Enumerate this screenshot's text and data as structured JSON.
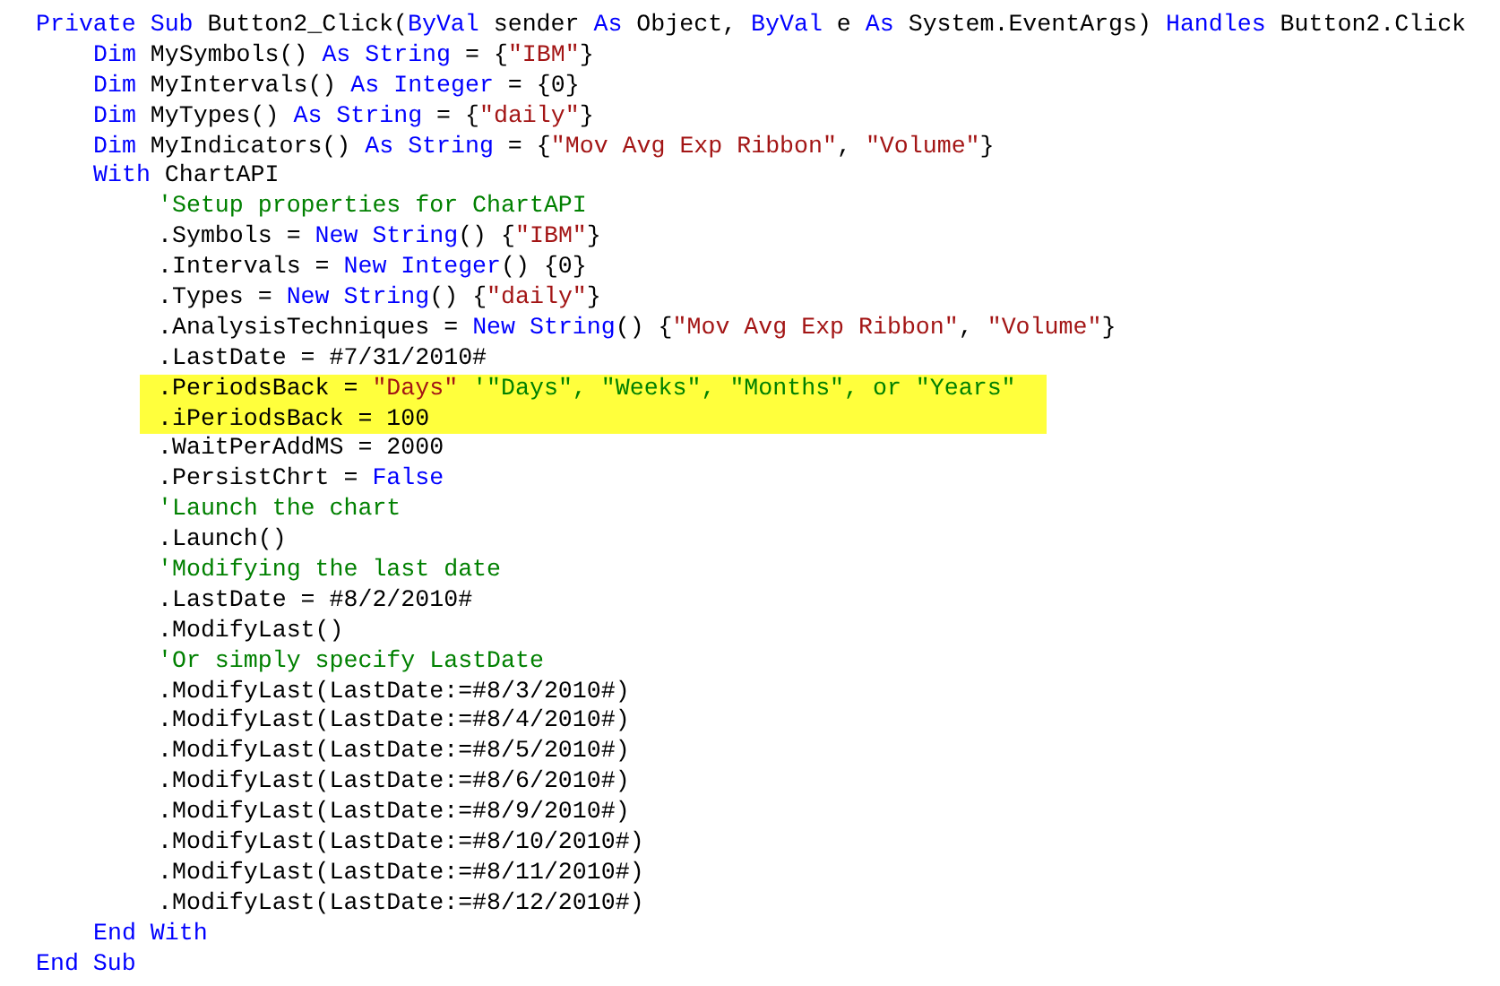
{
  "code_editor": {
    "lines": [
      {
        "tokens": [
          {
            "kind": "keyword",
            "text": "Private Sub"
          },
          {
            "kind": "plain",
            "text": " Button2_Click("
          },
          {
            "kind": "keyword",
            "text": "ByVal"
          },
          {
            "kind": "plain",
            "text": " sender "
          },
          {
            "kind": "keyword",
            "text": "As"
          },
          {
            "kind": "plain",
            "text": " Object, "
          },
          {
            "kind": "keyword",
            "text": "ByVal"
          },
          {
            "kind": "plain",
            "text": " e "
          },
          {
            "kind": "keyword",
            "text": "As"
          },
          {
            "kind": "plain",
            "text": " System.EventArgs) "
          },
          {
            "kind": "keyword",
            "text": "Handles"
          },
          {
            "kind": "plain",
            "text": " Button2.Click"
          }
        ],
        "children": [
          {
            "tokens": [
              {
                "kind": "keyword",
                "text": "Dim"
              },
              {
                "kind": "plain",
                "text": " MySymbols() "
              },
              {
                "kind": "keyword",
                "text": "As String"
              },
              {
                "kind": "plain",
                "text": " = {"
              },
              {
                "kind": "string",
                "text": "\"IBM\""
              },
              {
                "kind": "plain",
                "text": "}"
              }
            ]
          },
          {
            "tokens": [
              {
                "kind": "keyword",
                "text": "Dim"
              },
              {
                "kind": "plain",
                "text": " MyIntervals() "
              },
              {
                "kind": "keyword",
                "text": "As Integer"
              },
              {
                "kind": "plain",
                "text": " = {0}"
              }
            ]
          },
          {
            "tokens": [
              {
                "kind": "keyword",
                "text": "Dim"
              },
              {
                "kind": "plain",
                "text": " MyTypes() "
              },
              {
                "kind": "keyword",
                "text": "As String"
              },
              {
                "kind": "plain",
                "text": " = {"
              },
              {
                "kind": "string",
                "text": "\"daily\""
              },
              {
                "kind": "plain",
                "text": "}"
              }
            ]
          },
          {
            "tokens": [
              {
                "kind": "keyword",
                "text": "Dim"
              },
              {
                "kind": "plain",
                "text": " MyIndicators() "
              },
              {
                "kind": "keyword",
                "text": "As String"
              },
              {
                "kind": "plain",
                "text": " = {"
              },
              {
                "kind": "string",
                "text": "\"Mov Avg Exp Ribbon\""
              },
              {
                "kind": "plain",
                "text": ", "
              },
              {
                "kind": "string",
                "text": "\"Volume\""
              },
              {
                "kind": "plain",
                "text": "}"
              }
            ]
          },
          {
            "tokens": [
              {
                "kind": "keyword",
                "text": "With"
              },
              {
                "kind": "plain",
                "text": " ChartAPI"
              }
            ],
            "children": [
              {
                "highlighted": false,
                "tokens": [
                  {
                    "kind": "comment",
                    "text": "'Setup properties for ChartAPI"
                  }
                ]
              },
              {
                "highlighted": false,
                "tokens": [
                  {
                    "kind": "plain",
                    "text": ".Symbols = "
                  },
                  {
                    "kind": "keyword",
                    "text": "New String"
                  },
                  {
                    "kind": "plain",
                    "text": "() {"
                  },
                  {
                    "kind": "string",
                    "text": "\"IBM\""
                  },
                  {
                    "kind": "plain",
                    "text": "}"
                  }
                ]
              },
              {
                "highlighted": false,
                "tokens": [
                  {
                    "kind": "plain",
                    "text": ".Intervals = "
                  },
                  {
                    "kind": "keyword",
                    "text": "New Integer"
                  },
                  {
                    "kind": "plain",
                    "text": "() {0}"
                  }
                ]
              },
              {
                "highlighted": false,
                "tokens": [
                  {
                    "kind": "plain",
                    "text": ".Types = "
                  },
                  {
                    "kind": "keyword",
                    "text": "New String"
                  },
                  {
                    "kind": "plain",
                    "text": "() {"
                  },
                  {
                    "kind": "string",
                    "text": "\"daily\""
                  },
                  {
                    "kind": "plain",
                    "text": "}"
                  }
                ]
              },
              {
                "highlighted": false,
                "tokens": [
                  {
                    "kind": "plain",
                    "text": ".AnalysisTechniques = "
                  },
                  {
                    "kind": "keyword",
                    "text": "New String"
                  },
                  {
                    "kind": "plain",
                    "text": "() {"
                  },
                  {
                    "kind": "string",
                    "text": "\"Mov Avg Exp Ribbon\""
                  },
                  {
                    "kind": "plain",
                    "text": ", "
                  },
                  {
                    "kind": "string",
                    "text": "\"Volume\""
                  },
                  {
                    "kind": "plain",
                    "text": "}"
                  }
                ]
              },
              {
                "highlighted": false,
                "tokens": [
                  {
                    "kind": "plain",
                    "text": ".LastDate = #7/31/2010#"
                  }
                ]
              },
              {
                "highlighted": true,
                "tokens": [
                  {
                    "kind": "plain",
                    "text": ".PeriodsBack = "
                  },
                  {
                    "kind": "string",
                    "text": "\"Days\""
                  },
                  {
                    "kind": "comment",
                    "text": " '\"Days\", \"Weeks\", \"Months\", or \"Years\""
                  }
                ]
              },
              {
                "highlighted": true,
                "tokens": [
                  {
                    "kind": "plain",
                    "text": ".iPeriodsBack = 100"
                  }
                ]
              },
              {
                "highlighted": false,
                "tokens": [
                  {
                    "kind": "plain",
                    "text": ".WaitPerAddMS = 2000"
                  }
                ]
              },
              {
                "highlighted": false,
                "tokens": [
                  {
                    "kind": "plain",
                    "text": ".PersistChrt = "
                  },
                  {
                    "kind": "keyword",
                    "text": "False"
                  }
                ]
              },
              {
                "highlighted": false,
                "tokens": [
                  {
                    "kind": "comment",
                    "text": "'Launch the chart"
                  }
                ]
              },
              {
                "highlighted": false,
                "tokens": [
                  {
                    "kind": "plain",
                    "text": ".Launch()"
                  }
                ]
              },
              {
                "highlighted": false,
                "tokens": [
                  {
                    "kind": "comment",
                    "text": "'Modifying the last date"
                  }
                ]
              },
              {
                "highlighted": false,
                "tokens": [
                  {
                    "kind": "plain",
                    "text": ".LastDate = #8/2/2010#"
                  }
                ]
              },
              {
                "highlighted": false,
                "tokens": [
                  {
                    "kind": "plain",
                    "text": ".ModifyLast()"
                  }
                ]
              },
              {
                "highlighted": false,
                "tokens": [
                  {
                    "kind": "comment",
                    "text": "'Or simply specify LastDate"
                  }
                ]
              },
              {
                "highlighted": false,
                "tokens": [
                  {
                    "kind": "plain",
                    "text": ".ModifyLast(LastDate:=#8/3/2010#)"
                  }
                ]
              },
              {
                "highlighted": false,
                "tokens": [
                  {
                    "kind": "plain",
                    "text": ".ModifyLast(LastDate:=#8/4/2010#)"
                  }
                ]
              },
              {
                "highlighted": false,
                "tokens": [
                  {
                    "kind": "plain",
                    "text": ".ModifyLast(LastDate:=#8/5/2010#)"
                  }
                ]
              },
              {
                "highlighted": false,
                "tokens": [
                  {
                    "kind": "plain",
                    "text": ".ModifyLast(LastDate:=#8/6/2010#)"
                  }
                ]
              },
              {
                "highlighted": false,
                "tokens": [
                  {
                    "kind": "plain",
                    "text": ".ModifyLast(LastDate:=#8/9/2010#)"
                  }
                ]
              },
              {
                "highlighted": false,
                "tokens": [
                  {
                    "kind": "plain",
                    "text": ".ModifyLast(LastDate:=#8/10/2010#)"
                  }
                ]
              },
              {
                "highlighted": false,
                "tokens": [
                  {
                    "kind": "plain",
                    "text": ".ModifyLast(LastDate:=#8/11/2010#)"
                  }
                ]
              },
              {
                "highlighted": false,
                "tokens": [
                  {
                    "kind": "plain",
                    "text": ".ModifyLast(LastDate:=#8/12/2010#)"
                  }
                ]
              }
            ]
          },
          {
            "tokens": [
              {
                "kind": "keyword",
                "text": "End With"
              }
            ]
          }
        ]
      },
      {
        "tokens": [
          {
            "kind": "keyword",
            "text": "End Sub"
          }
        ]
      }
    ]
  }
}
